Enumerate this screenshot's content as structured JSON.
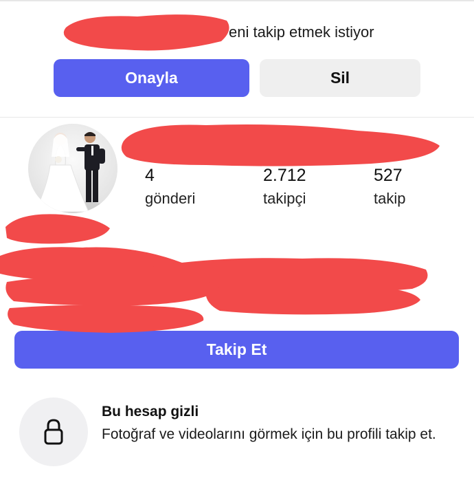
{
  "request": {
    "text": "eni takip etmek istiyor",
    "approve_label": "Onayla",
    "delete_label": "Sil"
  },
  "profile": {
    "stats": [
      {
        "value": "4",
        "label": "gönderi"
      },
      {
        "value": "2.712",
        "label": "takipçi"
      },
      {
        "value": "527",
        "label": "takip"
      }
    ],
    "follow_label": "Takip Et"
  },
  "private": {
    "title": "Bu hesap gizli",
    "description": "Fotoğraf ve videolarını görmek için bu profili takip et.",
    "icon": "lock-icon"
  },
  "colors": {
    "primary_button": "#5860ef",
    "secondary_button": "#efefef",
    "redaction": "#f24a4a"
  }
}
